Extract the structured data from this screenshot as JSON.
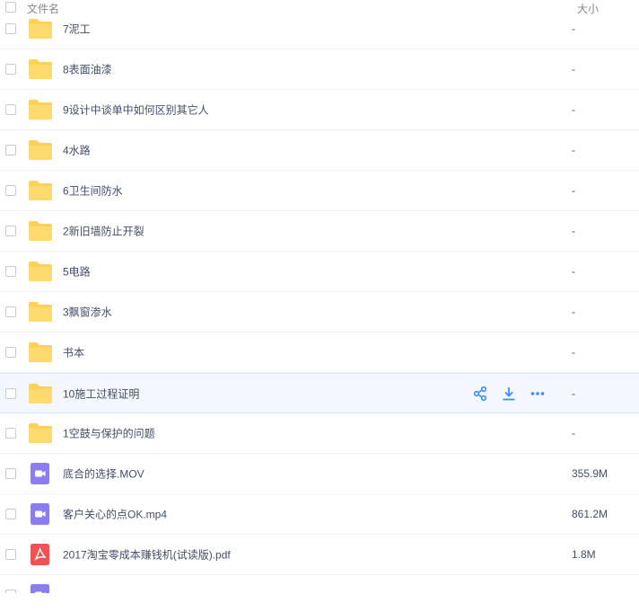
{
  "header": {
    "name_label": "文件名",
    "size_label": "大小"
  },
  "colors": {
    "folder": "#ffd05a",
    "video": "#8b7df0",
    "pdf": "#f15353",
    "action": "#3b8cff"
  },
  "rows": [
    {
      "name": "7泥工",
      "size": "-",
      "type": "folder-icon"
    },
    {
      "name": "8表面油漆",
      "size": "-",
      "type": "folder-icon"
    },
    {
      "name": "9设计中谈单中如何区别其它人",
      "size": "-",
      "type": "folder-icon"
    },
    {
      "name": "4水路",
      "size": "-",
      "type": "folder-icon"
    },
    {
      "name": "6卫生间防水",
      "size": "-",
      "type": "folder-icon"
    },
    {
      "name": "2新旧墙防止开裂",
      "size": "-",
      "type": "folder-icon"
    },
    {
      "name": "5电路",
      "size": "-",
      "type": "folder-icon"
    },
    {
      "name": "3飘窗渗水",
      "size": "-",
      "type": "folder-icon"
    },
    {
      "name": "书本",
      "size": "-",
      "type": "folder-icon"
    },
    {
      "name": "10施工过程证明",
      "size": "-",
      "type": "folder-icon",
      "hover": true
    },
    {
      "name": "1空鼓与保护的问题",
      "size": "-",
      "type": "folder-icon"
    },
    {
      "name": "底合的选择.MOV",
      "size": "355.9M",
      "type": "video-file-icon"
    },
    {
      "name": "客户关心的点OK.mp4",
      "size": "861.2M",
      "type": "video-file-icon"
    },
    {
      "name": "2017淘宝零成本赚钱机(试读版).pdf",
      "size": "1.8M",
      "type": "pdf-file-icon"
    },
    {
      "name": "",
      "size": "",
      "type": "video-file-icon"
    }
  ],
  "hover_actions": [
    "share-icon",
    "download-icon",
    "more-icon"
  ]
}
